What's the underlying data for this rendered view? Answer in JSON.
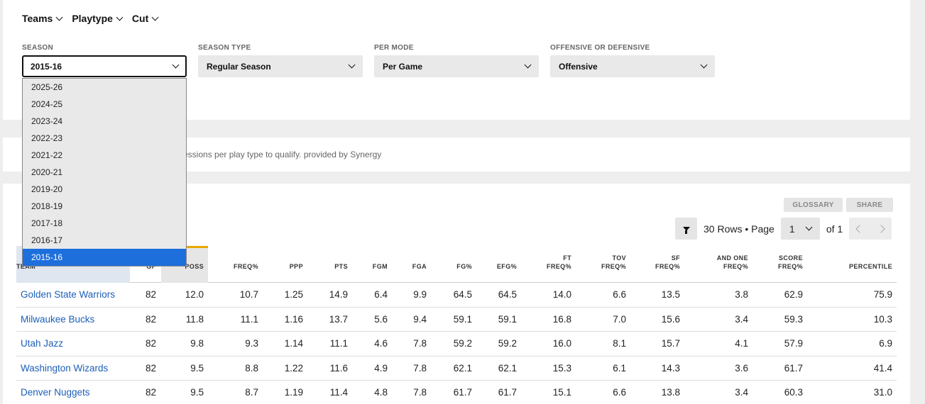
{
  "topnav": [
    {
      "label": "Teams"
    },
    {
      "label": "Playtype"
    },
    {
      "label": "Cut"
    }
  ],
  "filters": {
    "season": {
      "label": "SEASON",
      "value": "2015-16"
    },
    "season_type": {
      "label": "SEASON TYPE",
      "value": "Regular Season"
    },
    "per_mode": {
      "label": "PER MODE",
      "value": "Per Game"
    },
    "off_def": {
      "label": "OFFENSIVE OR DEFENSIVE",
      "value": "Offensive"
    }
  },
  "season_options": [
    "2025-26",
    "2024-25",
    "2023-24",
    "2022-23",
    "2021-22",
    "2020-21",
    "2019-20",
    "2018-19",
    "2017-18",
    "2016-17",
    "2015-16"
  ],
  "note": "essions per play type to qualify. provided by Synergy",
  "buttons": {
    "glossary": "GLOSSARY",
    "share": "SHARE"
  },
  "pager": {
    "rows_text": "30 Rows • Page",
    "page": "1",
    "of_text": "of 1"
  },
  "colors": {
    "accent": "#e8a800",
    "link": "#1d5fb8",
    "selected": "#1d6fdc"
  },
  "table": {
    "headers": {
      "team": "TEAM",
      "gp": "GP",
      "poss": "POSS",
      "freq": "FREQ%",
      "ppp": "PPP",
      "pts": "PTS",
      "fgm": "FGM",
      "fga": "FGA",
      "fgpct": "FG%",
      "efgpct": "EFG%",
      "ft_l1": "FT",
      "ft_l2": "FREQ%",
      "tov_l1": "TOV",
      "tov_l2": "FREQ%",
      "sf_l1": "SF",
      "sf_l2": "FREQ%",
      "andone_l1": "AND ONE",
      "andone_l2": "FREQ%",
      "score_l1": "SCORE",
      "score_l2": "FREQ%",
      "percentile": "PERCENTILE"
    },
    "rows": [
      {
        "team": "Golden State Warriors",
        "gp": "82",
        "poss": "12.0",
        "freq": "10.7",
        "ppp": "1.25",
        "pts": "14.9",
        "fgm": "6.4",
        "fga": "9.9",
        "fgpct": "64.5",
        "efgpct": "64.5",
        "ft": "14.0",
        "tov": "6.6",
        "sf": "13.5",
        "andone": "3.8",
        "score": "62.9",
        "percentile": "75.9"
      },
      {
        "team": "Milwaukee Bucks",
        "gp": "82",
        "poss": "11.8",
        "freq": "11.1",
        "ppp": "1.16",
        "pts": "13.7",
        "fgm": "5.6",
        "fga": "9.4",
        "fgpct": "59.1",
        "efgpct": "59.1",
        "ft": "16.8",
        "tov": "7.0",
        "sf": "15.6",
        "andone": "3.4",
        "score": "59.3",
        "percentile": "10.3"
      },
      {
        "team": "Utah Jazz",
        "gp": "82",
        "poss": "9.8",
        "freq": "9.3",
        "ppp": "1.14",
        "pts": "11.1",
        "fgm": "4.6",
        "fga": "7.8",
        "fgpct": "59.2",
        "efgpct": "59.2",
        "ft": "16.0",
        "tov": "8.1",
        "sf": "15.7",
        "andone": "4.1",
        "score": "57.9",
        "percentile": "6.9"
      },
      {
        "team": "Washington Wizards",
        "gp": "82",
        "poss": "9.5",
        "freq": "8.8",
        "ppp": "1.22",
        "pts": "11.6",
        "fgm": "4.9",
        "fga": "7.8",
        "fgpct": "62.1",
        "efgpct": "62.1",
        "ft": "15.3",
        "tov": "6.1",
        "sf": "14.3",
        "andone": "3.6",
        "score": "61.7",
        "percentile": "41.4"
      },
      {
        "team": "Denver Nuggets",
        "gp": "82",
        "poss": "9.5",
        "freq": "8.7",
        "ppp": "1.19",
        "pts": "11.4",
        "fgm": "4.8",
        "fga": "7.8",
        "fgpct": "61.7",
        "efgpct": "61.7",
        "ft": "15.1",
        "tov": "6.6",
        "sf": "13.8",
        "andone": "3.4",
        "score": "60.3",
        "percentile": "31.0"
      }
    ]
  }
}
